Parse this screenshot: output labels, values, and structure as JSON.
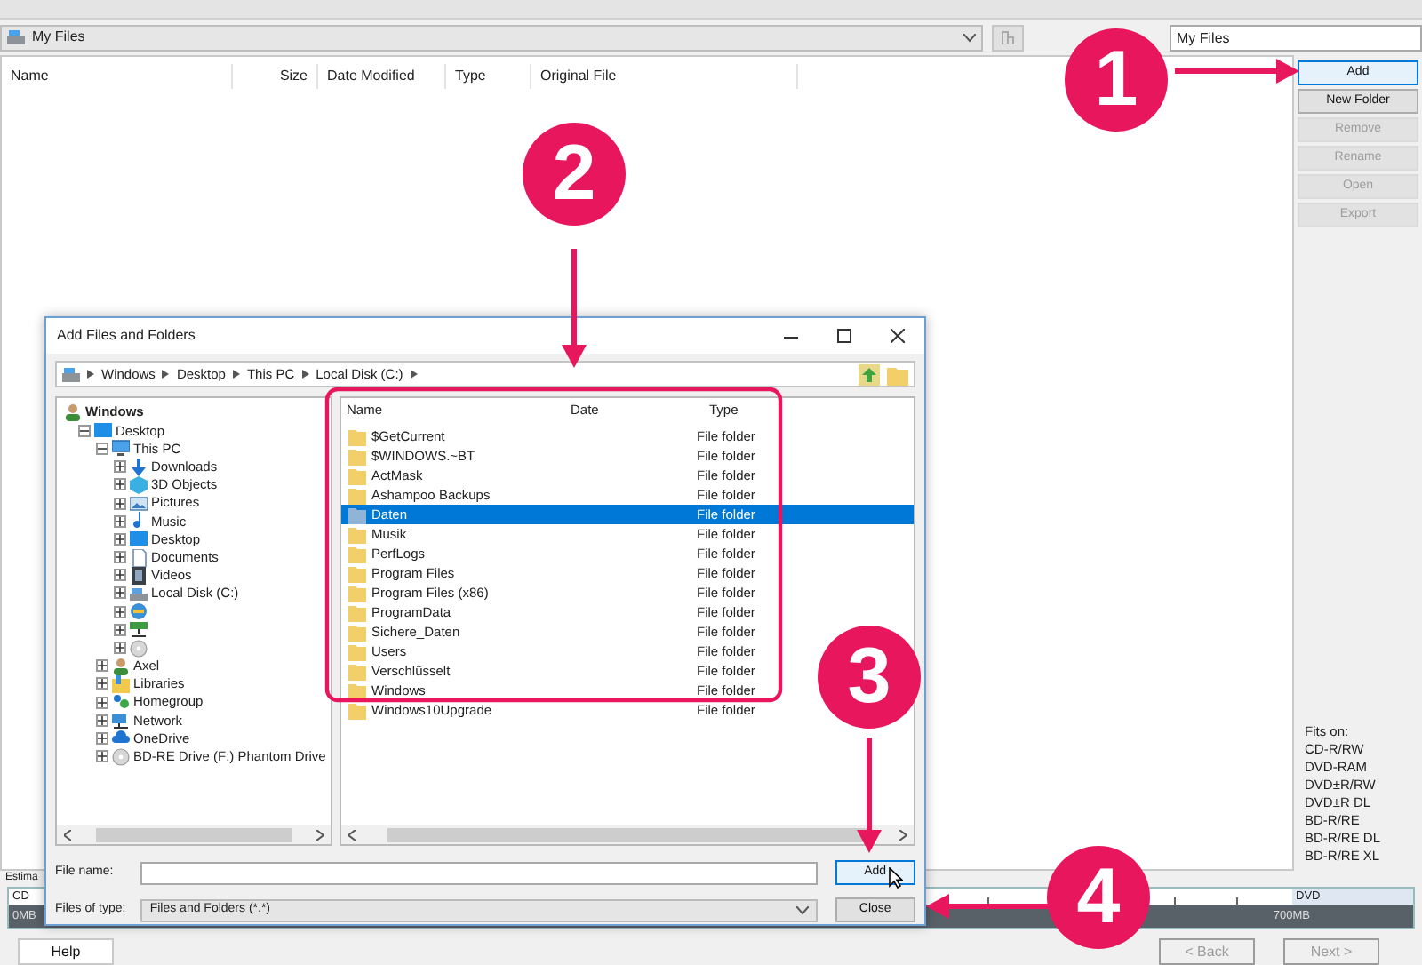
{
  "toolbar": {
    "path": "My Files",
    "name_field": "My Files"
  },
  "file_list": {
    "columns": [
      "Name",
      "Size",
      "Date Modified",
      "Type",
      "Original File"
    ]
  },
  "side_buttons": [
    {
      "label": "Add",
      "disabled": false,
      "focused": true
    },
    {
      "label": "New Folder",
      "disabled": false,
      "focused": false
    },
    {
      "label": "Remove",
      "disabled": true,
      "focused": false
    },
    {
      "label": "Rename",
      "disabled": true,
      "focused": false
    },
    {
      "label": "Open",
      "disabled": true,
      "focused": false
    },
    {
      "label": "Export",
      "disabled": true,
      "focused": false
    }
  ],
  "fits_on": {
    "label": "Fits on:",
    "media": [
      "CD-R/RW",
      "DVD-RAM",
      "DVD±R/RW",
      "DVD±R DL",
      "BD-R/RE",
      "BD-R/RE DL",
      "BD-R/RE XL"
    ]
  },
  "estimate": {
    "label": "Estima",
    "left_media": "CD",
    "left_size": "0MB",
    "right_media": "DVD",
    "right_size": "700MB"
  },
  "footer": [
    {
      "label": "Help",
      "disabled": false
    },
    {
      "label": "< Back",
      "disabled": true
    },
    {
      "label": "Next >",
      "disabled": true
    }
  ],
  "dialog": {
    "title": "Add Files and Folders",
    "breadcrumb": [
      "Windows",
      "Desktop",
      "This PC",
      "Local Disk (C:)"
    ],
    "tree": [
      {
        "label": "Windows",
        "kind": "user",
        "children": [
          {
            "label": "Desktop",
            "kind": "desktop",
            "expanded": true,
            "children": [
              {
                "label": "This PC",
                "kind": "pc",
                "expanded": true,
                "children": [
                  {
                    "label": "Downloads",
                    "kind": "download",
                    "expanded": false
                  },
                  {
                    "label": "3D Objects",
                    "kind": "cube",
                    "expanded": false
                  },
                  {
                    "label": "Pictures",
                    "kind": "pictures",
                    "expanded": false
                  },
                  {
                    "label": "Music",
                    "kind": "music",
                    "expanded": false
                  },
                  {
                    "label": "Desktop",
                    "kind": "desktop",
                    "expanded": false
                  },
                  {
                    "label": "Documents",
                    "kind": "document",
                    "expanded": false
                  },
                  {
                    "label": "Videos",
                    "kind": "video",
                    "expanded": false
                  },
                  {
                    "label": "Local Disk (C:)",
                    "kind": "drive",
                    "expanded": false
                  },
                  {
                    "kind": "globe",
                    "expanded": false
                  },
                  {
                    "kind": "netdrive",
                    "expanded": false
                  },
                  {
                    "kind": "disc",
                    "expanded": false
                  }
                ]
              },
              {
                "label": "Axel",
                "kind": "user",
                "expanded": false
              },
              {
                "label": "Libraries",
                "kind": "library",
                "expanded": false
              },
              {
                "label": "Homegroup",
                "kind": "homegroup",
                "expanded": false
              },
              {
                "label": "Network",
                "kind": "network",
                "expanded": false
              },
              {
                "label": "OneDrive",
                "kind": "cloud",
                "expanded": false
              },
              {
                "label": "BD-RE Drive (F:) Phantom Drive",
                "kind": "disc",
                "expanded": false
              }
            ]
          }
        ]
      }
    ],
    "columns": [
      "Name",
      "Date",
      "Type"
    ],
    "rows": [
      {
        "name": "$GetCurrent",
        "type": "File folder",
        "selected": false
      },
      {
        "name": "$WINDOWS.~BT",
        "type": "File folder",
        "selected": false
      },
      {
        "name": "ActMask",
        "type": "File folder",
        "selected": false
      },
      {
        "name": "Ashampoo Backups",
        "type": "File folder",
        "selected": false
      },
      {
        "name": "Daten",
        "type": "File folder",
        "selected": true
      },
      {
        "name": "Musik",
        "type": "File folder",
        "selected": false
      },
      {
        "name": "PerfLogs",
        "type": "File folder",
        "selected": false
      },
      {
        "name": "Program Files",
        "type": "File folder",
        "selected": false
      },
      {
        "name": "Program Files (x86)",
        "type": "File folder",
        "selected": false
      },
      {
        "name": "ProgramData",
        "type": "File folder",
        "selected": false
      },
      {
        "name": "Sichere_Daten",
        "type": "File folder",
        "selected": false
      },
      {
        "name": "Users",
        "type": "File folder",
        "selected": false
      },
      {
        "name": "Verschlüsselt",
        "type": "File folder",
        "selected": false
      },
      {
        "name": "Windows",
        "type": "File folder",
        "selected": false
      },
      {
        "name": "Windows10Upgrade",
        "type": "File folder",
        "selected": false
      }
    ],
    "file_name_label": "File name:",
    "file_type": {
      "label": "Files of type:",
      "value": "Files and Folders (*.*)"
    },
    "buttons": [
      "Add",
      "Close"
    ]
  },
  "callouts": [
    "1",
    "2",
    "3",
    "4"
  ]
}
